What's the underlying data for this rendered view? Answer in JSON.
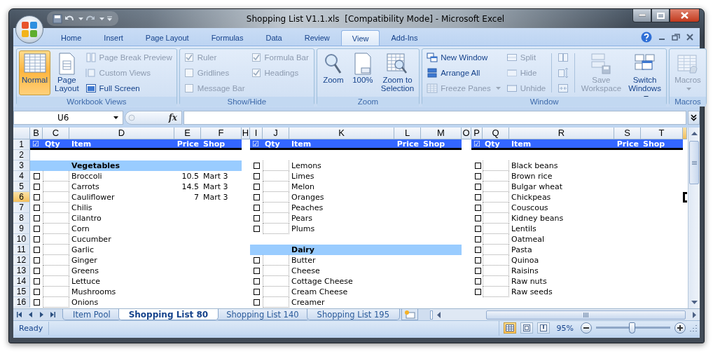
{
  "window": {
    "title": "Shopping List V1.1.xls  [Compatibility Mode] - Microsoft Excel"
  },
  "ribbon": {
    "tabs": [
      {
        "label": "Home",
        "selected": false
      },
      {
        "label": "Insert",
        "selected": false
      },
      {
        "label": "Page Layout",
        "selected": false
      },
      {
        "label": "Formulas",
        "selected": false
      },
      {
        "label": "Data",
        "selected": false
      },
      {
        "label": "Review",
        "selected": false
      },
      {
        "label": "View",
        "selected": true
      },
      {
        "label": "Add-Ins",
        "selected": false
      }
    ],
    "groups": [
      {
        "title": "Workbook Views",
        "columns": [
          [
            {
              "kind": "large",
              "label": "Normal",
              "selected": true,
              "disabled": false
            }
          ],
          [
            {
              "kind": "large",
              "label": "Page Layout",
              "selected": false,
              "disabled": false
            }
          ],
          [
            {
              "kind": "small",
              "label": "Page Break Preview",
              "disabled": true
            },
            {
              "kind": "small",
              "label": "Custom Views",
              "disabled": true
            },
            {
              "kind": "small",
              "label": "Full Screen",
              "disabled": false
            }
          ]
        ]
      },
      {
        "title": "Show/Hide",
        "columns": [
          [
            {
              "kind": "check",
              "label": "Ruler",
              "checked": true,
              "disabled": true
            },
            {
              "kind": "check",
              "label": "Gridlines",
              "checked": false,
              "disabled": true
            },
            {
              "kind": "check",
              "label": "Message Bar",
              "checked": false,
              "disabled": true
            }
          ],
          [
            {
              "kind": "check",
              "label": "Formula Bar",
              "checked": true,
              "disabled": true
            },
            {
              "kind": "check",
              "label": "Headings",
              "checked": true,
              "disabled": true
            }
          ]
        ]
      },
      {
        "title": "Zoom",
        "columns": [
          [
            {
              "kind": "large",
              "label": "Zoom",
              "disabled": false
            }
          ],
          [
            {
              "kind": "large",
              "label": "100%",
              "disabled": false
            }
          ],
          [
            {
              "kind": "large",
              "label": "Zoom to Selection",
              "disabled": false
            }
          ]
        ]
      },
      {
        "title": "Window",
        "columns": [
          [
            {
              "kind": "small",
              "label": "New Window",
              "disabled": false
            },
            {
              "kind": "small",
              "label": "Arrange All",
              "disabled": false
            },
            {
              "kind": "small",
              "label": "Freeze Panes",
              "disabled": true,
              "dropdown": true
            }
          ],
          [
            {
              "kind": "small",
              "label": "Split",
              "disabled": true
            },
            {
              "kind": "small",
              "label": "Hide",
              "disabled": true
            },
            {
              "kind": "small",
              "label": "Unhide",
              "disabled": true
            }
          ],
          [
            {
              "kind": "icon",
              "disabled": true
            },
            {
              "kind": "icon",
              "disabled": true
            },
            {
              "kind": "icon",
              "disabled": true
            }
          ],
          [
            {
              "kind": "large",
              "label": "Save Workspace",
              "disabled": true
            }
          ],
          [
            {
              "kind": "large",
              "label": "Switch Windows",
              "disabled": false,
              "dropdown": true
            }
          ]
        ]
      },
      {
        "title": "Macros",
        "columns": [
          [
            {
              "kind": "large",
              "label": "Macros",
              "disabled": true,
              "dropdown": true
            }
          ]
        ]
      }
    ]
  },
  "formula_bar": {
    "name_box": "U6",
    "function_label": "fx"
  },
  "columns": [
    {
      "label": "B",
      "selected": false
    },
    {
      "label": "C",
      "selected": false
    },
    {
      "label": "D",
      "selected": false
    },
    {
      "label": "E",
      "selected": false
    },
    {
      "label": "F",
      "selected": false
    },
    {
      "label": "H",
      "selected": false
    },
    {
      "label": "I",
      "selected": false
    },
    {
      "label": "J",
      "selected": false
    },
    {
      "label": "K",
      "selected": false
    },
    {
      "label": "L",
      "selected": false
    },
    {
      "label": "M",
      "selected": false
    },
    {
      "label": "O",
      "selected": false
    },
    {
      "label": "P",
      "selected": false
    },
    {
      "label": "Q",
      "selected": false
    },
    {
      "label": "R",
      "selected": false
    },
    {
      "label": "S",
      "selected": false
    },
    {
      "label": "T",
      "selected": false
    }
  ],
  "edge_column": {
    "selected": true
  },
  "rows": [
    {
      "label": "1",
      "selected": false
    },
    {
      "label": "2",
      "selected": false
    },
    {
      "label": "3",
      "selected": false
    },
    {
      "label": "4",
      "selected": false
    },
    {
      "label": "5",
      "selected": false
    },
    {
      "label": "6",
      "selected": true
    },
    {
      "label": "7",
      "selected": false
    },
    {
      "label": "8",
      "selected": false
    },
    {
      "label": "9",
      "selected": false
    },
    {
      "label": "10",
      "selected": false
    },
    {
      "label": "11",
      "selected": false
    },
    {
      "label": "12",
      "selected": false
    },
    {
      "label": "13",
      "selected": false
    },
    {
      "label": "14",
      "selected": false
    },
    {
      "label": "15",
      "selected": false
    },
    {
      "label": "16",
      "selected": false
    }
  ],
  "blocks": [
    {
      "header": {
        "check": "☑",
        "qty": "Qty",
        "item": "Item",
        "price": "Price",
        "shop": "Shop"
      },
      "rows": [
        {
          "kind": "blank"
        },
        {
          "kind": "category",
          "item": "Vegetables"
        },
        {
          "kind": "item",
          "checked": false,
          "item": "Broccoli",
          "price": "10.5",
          "shop": "Mart 3"
        },
        {
          "kind": "item",
          "checked": false,
          "item": "Carrots",
          "price": "14.5",
          "shop": "Mart 3"
        },
        {
          "kind": "item",
          "checked": false,
          "item": "Cauliflower",
          "price": "7",
          "shop": "Mart 3"
        },
        {
          "kind": "item",
          "checked": false,
          "item": "Chilis"
        },
        {
          "kind": "item",
          "checked": false,
          "item": "Cilantro"
        },
        {
          "kind": "item",
          "checked": false,
          "item": "Corn"
        },
        {
          "kind": "item",
          "checked": false,
          "item": "Cucumber"
        },
        {
          "kind": "item",
          "checked": false,
          "item": "Garlic"
        },
        {
          "kind": "item",
          "checked": false,
          "item": "Ginger"
        },
        {
          "kind": "item",
          "checked": false,
          "item": "Greens"
        },
        {
          "kind": "item",
          "checked": false,
          "item": "Lettuce"
        },
        {
          "kind": "item",
          "checked": false,
          "item": "Mushrooms"
        },
        {
          "kind": "item",
          "checked": false,
          "item": "Onions"
        }
      ]
    },
    {
      "header": {
        "check": "☑",
        "qty": "Qty",
        "item": "Item",
        "price": "Price",
        "shop": "Shop"
      },
      "rows": [
        {
          "kind": "blank"
        },
        {
          "kind": "item",
          "checked": false,
          "item": "Lemons"
        },
        {
          "kind": "item",
          "checked": false,
          "item": "Limes"
        },
        {
          "kind": "item",
          "checked": false,
          "item": "Melon"
        },
        {
          "kind": "item",
          "checked": false,
          "item": "Oranges"
        },
        {
          "kind": "item",
          "checked": false,
          "item": "Peaches"
        },
        {
          "kind": "item",
          "checked": false,
          "item": "Pears"
        },
        {
          "kind": "item",
          "checked": false,
          "item": "Plums"
        },
        {
          "kind": "blank"
        },
        {
          "kind": "category",
          "item": "Dairy"
        },
        {
          "kind": "item",
          "checked": false,
          "item": "Butter"
        },
        {
          "kind": "item",
          "checked": false,
          "item": "Cheese"
        },
        {
          "kind": "item",
          "checked": false,
          "item": "Cottage Cheese"
        },
        {
          "kind": "item",
          "checked": false,
          "item": "Cream Cheese"
        },
        {
          "kind": "item",
          "checked": false,
          "item": "Creamer"
        }
      ]
    },
    {
      "header": {
        "check": "☑",
        "qty": "Qty",
        "item": "Item",
        "price": "Price",
        "shop": "Shop"
      },
      "rows": [
        {
          "kind": "blank"
        },
        {
          "kind": "item",
          "checked": false,
          "item": "Black beans"
        },
        {
          "kind": "item",
          "checked": false,
          "item": "Brown rice"
        },
        {
          "kind": "item",
          "checked": false,
          "item": "Bulgar wheat"
        },
        {
          "kind": "item",
          "checked": false,
          "item": "Chickpeas"
        },
        {
          "kind": "item",
          "checked": false,
          "item": "Couscous"
        },
        {
          "kind": "item",
          "checked": false,
          "item": "Kidney beans"
        },
        {
          "kind": "item",
          "checked": false,
          "item": "Lentils"
        },
        {
          "kind": "item",
          "checked": false,
          "item": "Oatmeal"
        },
        {
          "kind": "item",
          "checked": false,
          "item": "Pasta"
        },
        {
          "kind": "item",
          "checked": false,
          "item": "Quinoa"
        },
        {
          "kind": "item",
          "checked": false,
          "item": "Raisins"
        },
        {
          "kind": "item",
          "checked": false,
          "item": "Raw nuts"
        },
        {
          "kind": "item",
          "checked": false,
          "item": "Raw seeds"
        },
        {
          "kind": "blank"
        }
      ]
    }
  ],
  "sheet_tabs": [
    {
      "label": "Item Pool",
      "selected": false
    },
    {
      "label": "Shopping List 80",
      "selected": true
    },
    {
      "label": "Shopping List 140",
      "selected": false
    },
    {
      "label": "Shopping List 195",
      "selected": false
    }
  ],
  "status_bar": {
    "status": "Ready",
    "views": [
      {
        "selected": true
      },
      {
        "selected": false
      },
      {
        "selected": false
      }
    ],
    "zoom": "95%",
    "zoom_slider": {
      "level": 0.48
    }
  }
}
